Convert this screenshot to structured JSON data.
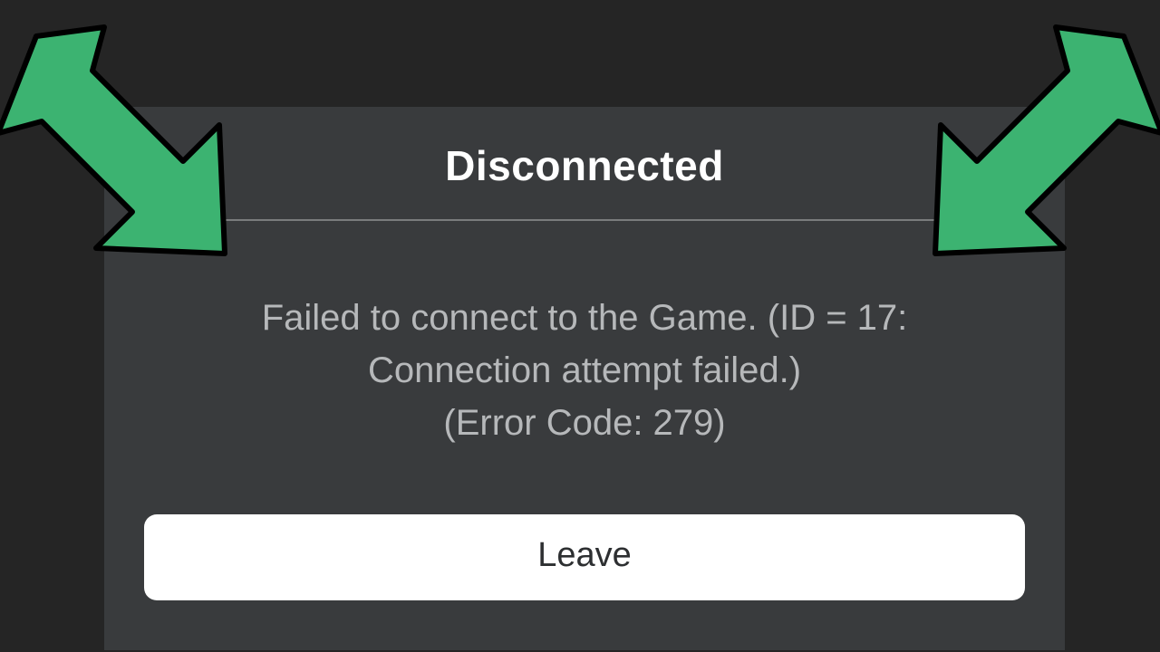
{
  "dialog": {
    "title": "Disconnected",
    "message": "Failed to connect to the Game. (ID = 17:\nConnection attempt failed.)\n(Error Code: 279)",
    "leave_label": "Leave"
  },
  "colors": {
    "arrow_fill": "#3cb371",
    "arrow_stroke": "#000000"
  }
}
